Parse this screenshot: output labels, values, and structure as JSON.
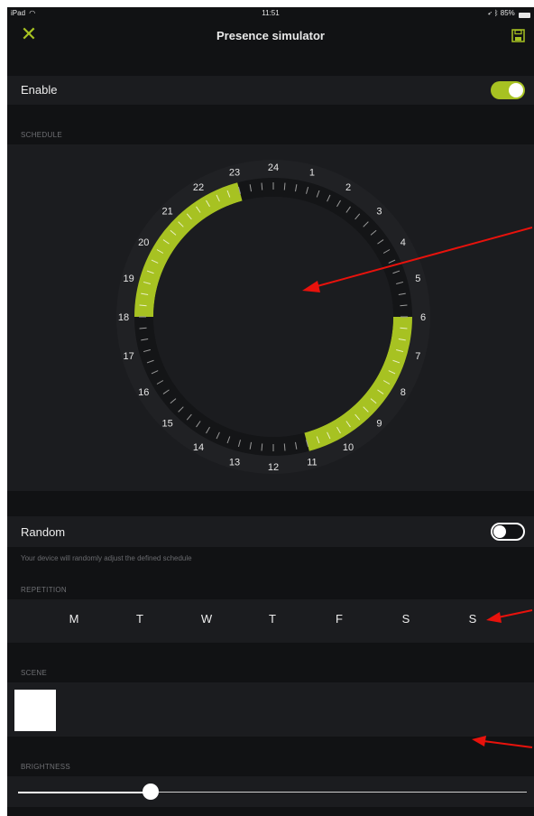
{
  "status_bar": {
    "device": "iPad",
    "wifi_icon": "wifi-icon",
    "time": "11:51",
    "battery": "85%",
    "battery_level": 0.85
  },
  "nav": {
    "title": "Presence simulator",
    "close_icon": "close-icon",
    "save_icon": "save-icon"
  },
  "colors": {
    "accent": "#a7c222",
    "background": "#111214",
    "row": "#1b1c1f",
    "annotation_arrow": "#e8120c"
  },
  "enable": {
    "label": "Enable",
    "value": true
  },
  "schedule": {
    "header": "SCHEDULE",
    "hours": [
      "24",
      "1",
      "2",
      "3",
      "4",
      "5",
      "6",
      "7",
      "8",
      "9",
      "10",
      "11",
      "12",
      "13",
      "14",
      "15",
      "16",
      "17",
      "18",
      "19",
      "20",
      "21",
      "22",
      "23"
    ],
    "active_ranges": [
      {
        "start": 6,
        "end": 11
      },
      {
        "start": 18,
        "end": 23
      }
    ]
  },
  "random": {
    "label": "Random",
    "value": false,
    "hint": "Your device will randomly adjust the defined schedule"
  },
  "repetition": {
    "header": "REPETITION",
    "days": [
      "M",
      "T",
      "W",
      "T",
      "F",
      "S",
      "S"
    ]
  },
  "scene": {
    "header": "SCENE",
    "swatch_color": "#ffffff"
  },
  "brightness": {
    "header": "BRIGHTNESS",
    "value": 0.26
  }
}
